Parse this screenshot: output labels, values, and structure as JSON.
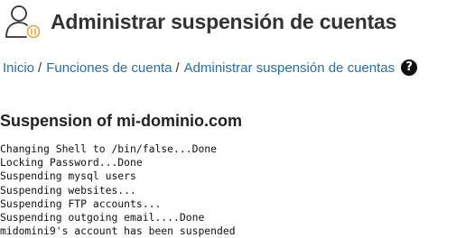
{
  "header": {
    "title": "Administrar suspensión de cuentas",
    "icon": "user-suspend-icon"
  },
  "breadcrumb": {
    "items": [
      {
        "label": "Inicio"
      },
      {
        "label": "Funciones de cuenta"
      }
    ],
    "separator": "/",
    "current": "Administrar suspensión de cuentas",
    "help_icon": "help-icon",
    "help_glyph": "?"
  },
  "section": {
    "title": "Suspension of mi-dominio.com"
  },
  "log": {
    "lines": [
      "Changing Shell to /bin/false...Done",
      "Locking Password...Done",
      "Suspending mysql users",
      "Suspending websites...",
      "Suspending FTP accounts...",
      "Suspending outgoing email....Done",
      "midomini9's account has been suspended"
    ]
  },
  "colors": {
    "link": "#1f6fb2",
    "text": "#333333",
    "icon_accent": "#e8a33d"
  }
}
